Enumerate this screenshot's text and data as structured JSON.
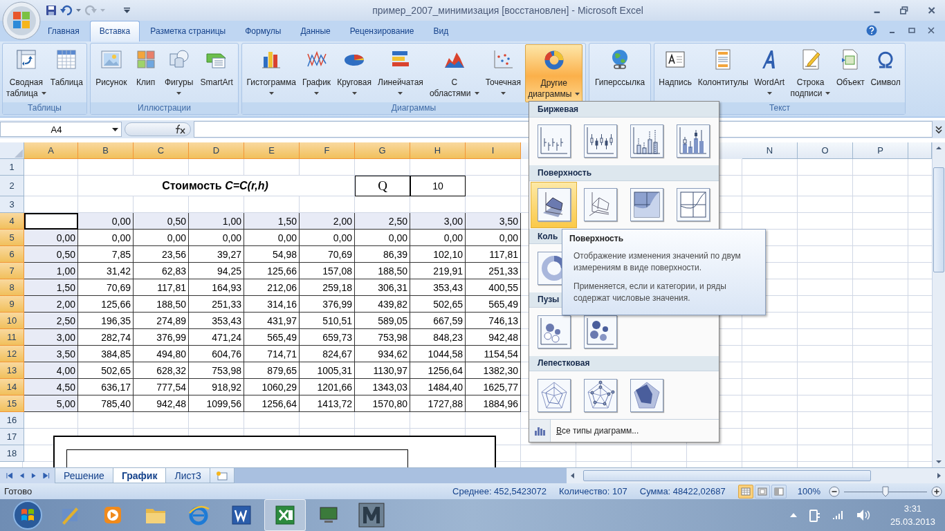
{
  "window": {
    "title": "пример_2007_минимизация [восстановлен] - Microsoft Excel"
  },
  "tabs": [
    {
      "label": "Главная",
      "selected": false
    },
    {
      "label": "Вставка",
      "selected": true
    },
    {
      "label": "Разметка страницы",
      "selected": false
    },
    {
      "label": "Формулы",
      "selected": false
    },
    {
      "label": "Данные",
      "selected": false
    },
    {
      "label": "Рецензирование",
      "selected": false
    },
    {
      "label": "Вид",
      "selected": false
    }
  ],
  "ribbon_groups": [
    {
      "label": "Таблицы",
      "buttons": [
        {
          "lines": [
            "Сводная",
            "таблица"
          ],
          "menu": true,
          "selected": false
        },
        {
          "lines": [
            "Таблица"
          ],
          "menu": false,
          "selected": false
        }
      ]
    },
    {
      "label": "Иллюстрации",
      "buttons": [
        {
          "lines": [
            "Рисунок"
          ],
          "menu": false,
          "selected": false
        },
        {
          "lines": [
            "Клип"
          ],
          "menu": false,
          "selected": false
        },
        {
          "lines": [
            "Фигуры"
          ],
          "menu": true,
          "selected": false
        },
        {
          "lines": [
            "SmartArt"
          ],
          "menu": false,
          "selected": false
        }
      ]
    },
    {
      "label": "Диаграммы",
      "buttons": [
        {
          "lines": [
            "Гистограмма"
          ],
          "menu": true,
          "selected": false
        },
        {
          "lines": [
            "График"
          ],
          "menu": true,
          "selected": false
        },
        {
          "lines": [
            "Круговая"
          ],
          "menu": true,
          "selected": false
        },
        {
          "lines": [
            "Линейчатая"
          ],
          "menu": true,
          "selected": false
        },
        {
          "lines": [
            "С",
            "областями"
          ],
          "menu": true,
          "selected": false
        },
        {
          "lines": [
            "Точечная"
          ],
          "menu": true,
          "selected": false
        },
        {
          "lines": [
            "Другие",
            "диаграммы"
          ],
          "menu": true,
          "selected": true
        }
      ]
    },
    {
      "buttons": [
        {
          "lines": [
            "Гиперссылка"
          ],
          "menu": false,
          "selected": false
        }
      ]
    },
    {
      "label": "Текст",
      "buttons": [
        {
          "lines": [
            "Надпись"
          ],
          "menu": false,
          "selected": false
        },
        {
          "lines": [
            "Колонтитулы"
          ],
          "menu": false,
          "selected": false
        },
        {
          "lines": [
            "WordArt"
          ],
          "menu": true,
          "selected": false
        },
        {
          "lines": [
            "Строка",
            "подписи"
          ],
          "menu": true,
          "selected": false
        },
        {
          "lines": [
            "Объект"
          ],
          "menu": false,
          "selected": false
        },
        {
          "lines": [
            "Символ"
          ],
          "menu": false,
          "selected": false
        }
      ]
    }
  ],
  "name_box": "A4",
  "columns": [
    {
      "label": "A",
      "highlighted": true
    },
    {
      "label": "B",
      "highlighted": true
    },
    {
      "label": "C",
      "highlighted": true
    },
    {
      "label": "D",
      "highlighted": true
    },
    {
      "label": "E",
      "highlighted": true
    },
    {
      "label": "F",
      "highlighted": true
    },
    {
      "label": "G",
      "highlighted": true
    },
    {
      "label": "H",
      "highlighted": true
    },
    {
      "label": "I",
      "highlighted": true
    },
    {
      "label": "N",
      "highlighted": false
    },
    {
      "label": "O",
      "highlighted": false
    },
    {
      "label": "P",
      "highlighted": false
    }
  ],
  "rows": [
    {
      "number": "1",
      "kind": "blank",
      "highlighted": false
    },
    {
      "number": "2",
      "kind": "title",
      "highlighted": false,
      "title": "Стоимость *C=C(r,h)*",
      "label": "Q",
      "value": "10"
    },
    {
      "number": "3",
      "kind": "blank",
      "highlighted": false
    },
    {
      "number": "4",
      "kind": "header",
      "highlighted": true,
      "cells": [
        "0,00",
        "0,50",
        "1,00",
        "1,50",
        "2,00",
        "2,50",
        "3,00",
        "3,50"
      ]
    },
    {
      "number": "5",
      "kind": "data",
      "highlighted": true,
      "cells": [
        "0,00",
        "0,00",
        "0,00",
        "0,00",
        "0,00",
        "0,00",
        "0,00",
        "0,00",
        "0,00"
      ]
    },
    {
      "number": "6",
      "kind": "data",
      "highlighted": true,
      "cells": [
        "0,50",
        "7,85",
        "23,56",
        "39,27",
        "54,98",
        "70,69",
        "86,39",
        "102,10",
        "117,81"
      ]
    },
    {
      "number": "7",
      "kind": "data",
      "highlighted": true,
      "cells": [
        "1,00",
        "31,42",
        "62,83",
        "94,25",
        "125,66",
        "157,08",
        "188,50",
        "219,91",
        "251,33"
      ]
    },
    {
      "number": "8",
      "kind": "data",
      "highlighted": true,
      "cells": [
        "1,50",
        "70,69",
        "117,81",
        "164,93",
        "212,06",
        "259,18",
        "306,31",
        "353,43",
        "400,55"
      ]
    },
    {
      "number": "9",
      "kind": "data",
      "highlighted": true,
      "cells": [
        "2,00",
        "125,66",
        "188,50",
        "251,33",
        "314,16",
        "376,99",
        "439,82",
        "502,65",
        "565,49"
      ]
    },
    {
      "number": "10",
      "kind": "data",
      "highlighted": true,
      "cells": [
        "2,50",
        "196,35",
        "274,89",
        "353,43",
        "431,97",
        "510,51",
        "589,05",
        "667,59",
        "746,13"
      ]
    },
    {
      "number": "11",
      "kind": "data",
      "highlighted": true,
      "cells": [
        "3,00",
        "282,74",
        "376,99",
        "471,24",
        "565,49",
        "659,73",
        "753,98",
        "848,23",
        "942,48"
      ]
    },
    {
      "number": "12",
      "kind": "data",
      "highlighted": true,
      "cells": [
        "3,50",
        "384,85",
        "494,80",
        "604,76",
        "714,71",
        "824,67",
        "934,62",
        "1044,58",
        "1154,54"
      ]
    },
    {
      "number": "13",
      "kind": "data",
      "highlighted": true,
      "cells": [
        "4,00",
        "502,65",
        "628,32",
        "753,98",
        "879,65",
        "1005,31",
        "1130,97",
        "1256,64",
        "1382,30"
      ]
    },
    {
      "number": "14",
      "kind": "data",
      "highlighted": true,
      "cells": [
        "4,50",
        "636,17",
        "777,54",
        "918,92",
        "1060,29",
        "1201,66",
        "1343,03",
        "1484,40",
        "1625,77"
      ]
    },
    {
      "number": "15",
      "kind": "data",
      "highlighted": true,
      "cells": [
        "5,00",
        "785,40",
        "942,48",
        "1099,56",
        "1256,64",
        "1413,72",
        "1570,80",
        "1727,88",
        "1884,96"
      ]
    },
    {
      "number": "16",
      "kind": "blank",
      "highlighted": false
    },
    {
      "number": "17",
      "kind": "blank",
      "highlighted": false
    },
    {
      "number": "18",
      "kind": "blank",
      "highlighted": false
    }
  ],
  "chart_menu": {
    "sections": [
      {
        "title": "Биржевая",
        "items": [
          {
            "kind": "hlc",
            "selected": false
          },
          {
            "kind": "ohlc",
            "selected": false
          },
          {
            "kind": "vhlc",
            "selected": false
          },
          {
            "kind": "vohlc",
            "selected": false
          }
        ]
      },
      {
        "title": "Поверхность",
        "items": [
          {
            "kind": "surface",
            "selected": true
          },
          {
            "kind": "wireframe",
            "selected": false
          },
          {
            "kind": "contour",
            "selected": false
          },
          {
            "kind": "wire-contour",
            "selected": false
          }
        ]
      },
      {
        "title": "Коль",
        "items": [
          {
            "kind": "doughnut",
            "selected": false
          }
        ]
      },
      {
        "title": "Пузы",
        "items": [
          {
            "kind": "bubble",
            "selected": false
          },
          {
            "kind": "bubble-3d",
            "selected": false
          }
        ]
      },
      {
        "title": "Лепестковая",
        "items": [
          {
            "kind": "radar",
            "selected": false
          },
          {
            "kind": "radar-markers",
            "selected": false
          },
          {
            "kind": "filled-radar",
            "selected": false
          }
        ]
      }
    ],
    "footer": "Все типы диаграмм..."
  },
  "tooltip": {
    "title": "Поверхность",
    "paragraphs": [
      "Отображение изменения значений по двум измерениям в виде поверхности.",
      "Применяется, если и категории, и ряды содержат числовые значения."
    ]
  },
  "sheet_tabs": [
    {
      "label": "Решение",
      "selected": false
    },
    {
      "label": "График",
      "selected": true
    },
    {
      "label": "Лист3",
      "selected": false
    }
  ],
  "status_bar": {
    "status": "Готово",
    "stats": [
      "Среднее: 452,5423072",
      "Количество: 107",
      "Сумма: 48422,02687"
    ],
    "views": [
      {
        "selected": true
      },
      {
        "selected": false
      },
      {
        "selected": false
      }
    ],
    "zoom": "100%",
    "zoom_slider": {
      "level": 0.5
    }
  },
  "taskbar": {
    "time": "3:31",
    "date": "25.03.2013"
  }
}
